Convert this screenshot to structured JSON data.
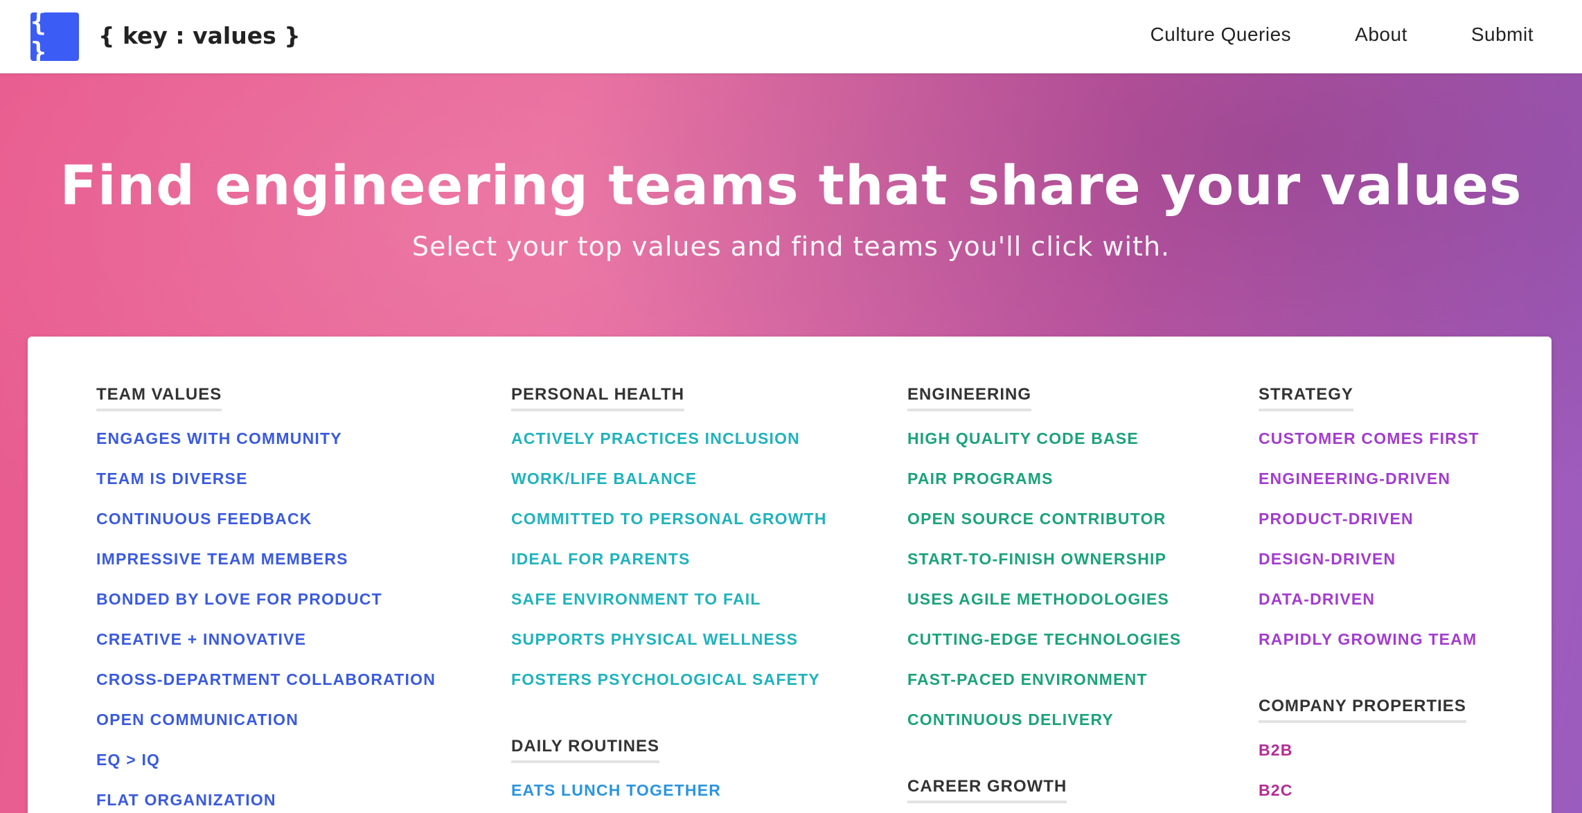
{
  "header": {
    "logo_glyph": "{ }",
    "brand": "{ key : values }",
    "nav": [
      "Culture Queries",
      "About",
      "Submit"
    ]
  },
  "hero": {
    "title": "Find engineering teams that share your values",
    "subtitle": "Select your top values and find teams you'll click with."
  },
  "categories": {
    "team_values": {
      "heading": "TEAM VALUES",
      "color": "#3a5ae0",
      "items": [
        "ENGAGES WITH COMMUNITY",
        "TEAM IS DIVERSE",
        "CONTINUOUS FEEDBACK",
        "IMPRESSIVE TEAM MEMBERS",
        "BONDED BY LOVE FOR PRODUCT",
        "CREATIVE + INNOVATIVE",
        "CROSS-DEPARTMENT COLLABORATION",
        "OPEN COMMUNICATION",
        "EQ > IQ",
        "FLAT ORGANIZATION"
      ]
    },
    "personal_health": {
      "heading": "PERSONAL HEALTH",
      "color": "#1eb3bd",
      "items": [
        "ACTIVELY PRACTICES INCLUSION",
        "WORK/LIFE BALANCE",
        "COMMITTED TO PERSONAL GROWTH",
        "IDEAL FOR PARENTS",
        "SAFE ENVIRONMENT TO FAIL",
        "SUPPORTS PHYSICAL WELLNESS",
        "FOSTERS PSYCHOLOGICAL SAFETY"
      ]
    },
    "daily_routines": {
      "heading": "DAILY ROUTINES",
      "color": "#2a95e0",
      "items": [
        "EATS LUNCH TOGETHER"
      ]
    },
    "engineering": {
      "heading": "ENGINEERING",
      "color": "#1aa37a",
      "items": [
        "HIGH QUALITY CODE BASE",
        "PAIR PROGRAMS",
        "OPEN SOURCE CONTRIBUTOR",
        "START-TO-FINISH OWNERSHIP",
        "USES AGILE METHODOLOGIES",
        "CUTTING-EDGE TECHNOLOGIES",
        "FAST-PACED ENVIRONMENT",
        "CONTINUOUS DELIVERY"
      ]
    },
    "career_growth": {
      "heading": "CAREER GROWTH",
      "items": []
    },
    "strategy": {
      "heading": "STRATEGY",
      "color": "#a33ccf",
      "items": [
        "CUSTOMER COMES FIRST",
        "ENGINEERING-DRIVEN",
        "PRODUCT-DRIVEN",
        "DESIGN-DRIVEN",
        "DATA-DRIVEN",
        "RAPIDLY GROWING TEAM"
      ]
    },
    "company_properties": {
      "heading": "COMPANY PROPERTIES",
      "color": "#b52c96",
      "items": [
        "B2B",
        "B2C"
      ]
    }
  }
}
